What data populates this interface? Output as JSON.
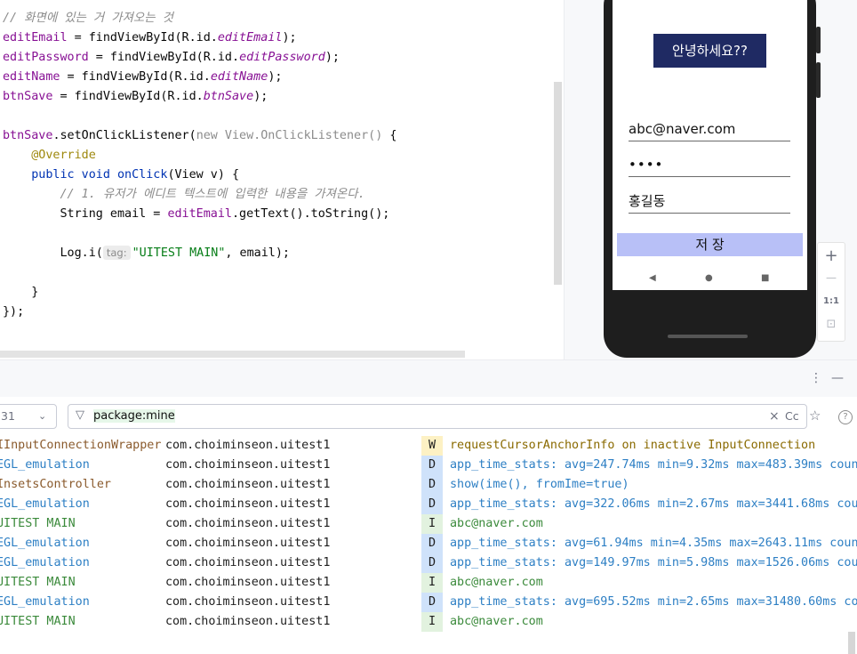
{
  "editor": {
    "lines": [
      {
        "parts": [
          {
            "t": "// 화면에 있는 거 가져오는 것",
            "c": "cm"
          }
        ]
      },
      {
        "parts": [
          {
            "t": "editEmail",
            "c": "fld"
          },
          {
            "t": " = findViewById(R.id.",
            "c": ""
          },
          {
            "t": "editEmail",
            "c": "fldi"
          },
          {
            "t": ");",
            "c": ""
          }
        ]
      },
      {
        "parts": [
          {
            "t": "editPassword",
            "c": "fld"
          },
          {
            "t": " = findViewById(R.id.",
            "c": ""
          },
          {
            "t": "editPassword",
            "c": "fldi"
          },
          {
            "t": ");",
            "c": ""
          }
        ]
      },
      {
        "parts": [
          {
            "t": "editName",
            "c": "fld"
          },
          {
            "t": " = findViewById(R.id.",
            "c": ""
          },
          {
            "t": "editName",
            "c": "fldi"
          },
          {
            "t": ");",
            "c": ""
          }
        ]
      },
      {
        "parts": [
          {
            "t": "btnSave",
            "c": "fld"
          },
          {
            "t": " = findViewById(R.id.",
            "c": ""
          },
          {
            "t": "btnSave",
            "c": "fldi"
          },
          {
            "t": ");",
            "c": ""
          }
        ]
      },
      {
        "parts": []
      },
      {
        "parts": [
          {
            "t": "btnSave",
            "c": "fld"
          },
          {
            "t": ".setOnClickListener(",
            "c": ""
          },
          {
            "t": "new View.OnClickListener() ",
            "c": "gray"
          },
          {
            "t": "{",
            "c": ""
          }
        ]
      },
      {
        "parts": [
          {
            "t": "    ",
            "c": ""
          },
          {
            "t": "@Override",
            "c": "ann"
          }
        ]
      },
      {
        "parts": [
          {
            "t": "    ",
            "c": ""
          },
          {
            "t": "public void",
            "c": "kw"
          },
          {
            "t": " onClick",
            "c": "kw"
          },
          {
            "t": "(View v) {",
            "c": ""
          }
        ]
      },
      {
        "parts": [
          {
            "t": "        ",
            "c": ""
          },
          {
            "t": "// 1. 유저가 에디트 텍스트에 입력한 내용을 가져온다.",
            "c": "cm"
          }
        ]
      },
      {
        "parts": [
          {
            "t": "        String email = ",
            "c": ""
          },
          {
            "t": "editEmail",
            "c": "fld"
          },
          {
            "t": ".getText().toString();",
            "c": ""
          }
        ]
      },
      {
        "parts": []
      },
      {
        "parts": [
          {
            "t": "        Log.i(",
            "c": ""
          },
          {
            "t": "tag:",
            "c": "hint"
          },
          {
            "t": "\"UITEST MAIN\"",
            "c": "str"
          },
          {
            "t": ", email);",
            "c": ""
          }
        ]
      },
      {
        "parts": []
      },
      {
        "parts": [
          {
            "t": "    }",
            "c": ""
          }
        ]
      },
      {
        "parts": [
          {
            "t": "});",
            "c": ""
          }
        ]
      }
    ]
  },
  "device": {
    "greeting": "안녕하세요??",
    "email_value": "abc@naver.com",
    "password_mask": "••••",
    "name_value": "홍길동",
    "save_label": "저 장",
    "nav": {
      "back": "◀",
      "home": "●",
      "recents": "■"
    },
    "zoom": {
      "plus": "+",
      "minus": "—",
      "ratio": "1:1",
      "fit": "⊡"
    }
  },
  "logcat": {
    "toolbar": {
      "more": "⋮",
      "minimize": "—"
    },
    "process_select": "31",
    "filter_query": "package:mine",
    "case_toggle": "Cc",
    "favorite": "☆",
    "clear": "×",
    "help": "?",
    "rows": [
      {
        "tag": "IInputConnectionWrapper",
        "tag_color": "brown",
        "package": "com.choiminseon.uitest1",
        "level": "W",
        "message": "requestCursorAnchorInfo on inactive InputConnection"
      },
      {
        "tag": "EGL_emulation",
        "tag_color": "blue",
        "package": "com.choiminseon.uitest1",
        "level": "D",
        "message": "app_time_stats: avg=247.74ms min=9.32ms max=483.39ms count"
      },
      {
        "tag": "InsetsController",
        "tag_color": "brown",
        "package": "com.choiminseon.uitest1",
        "level": "D",
        "message": "show(ime(), fromIme=true)"
      },
      {
        "tag": "EGL_emulation",
        "tag_color": "blue",
        "package": "com.choiminseon.uitest1",
        "level": "D",
        "message": "app_time_stats: avg=322.06ms min=2.67ms max=3441.68ms coun"
      },
      {
        "tag": "UITEST MAIN",
        "tag_color": "green",
        "package": "com.choiminseon.uitest1",
        "level": "I",
        "message": "abc@naver.com"
      },
      {
        "tag": "EGL_emulation",
        "tag_color": "blue",
        "package": "com.choiminseon.uitest1",
        "level": "D",
        "message": "app_time_stats: avg=61.94ms min=4.35ms max=2643.11ms count"
      },
      {
        "tag": "EGL_emulation",
        "tag_color": "blue",
        "package": "com.choiminseon.uitest1",
        "level": "D",
        "message": "app_time_stats: avg=149.97ms min=5.98ms max=1526.06ms coun"
      },
      {
        "tag": "UITEST MAIN",
        "tag_color": "green",
        "package": "com.choiminseon.uitest1",
        "level": "I",
        "message": "abc@naver.com"
      },
      {
        "tag": "EGL_emulation",
        "tag_color": "blue",
        "package": "com.choiminseon.uitest1",
        "level": "D",
        "message": "app_time_stats: avg=695.52ms min=2.65ms max=31480.60ms cou"
      },
      {
        "tag": "UITEST MAIN",
        "tag_color": "green",
        "package": "com.choiminseon.uitest1",
        "level": "I",
        "message": "abc@naver.com"
      }
    ]
  }
}
